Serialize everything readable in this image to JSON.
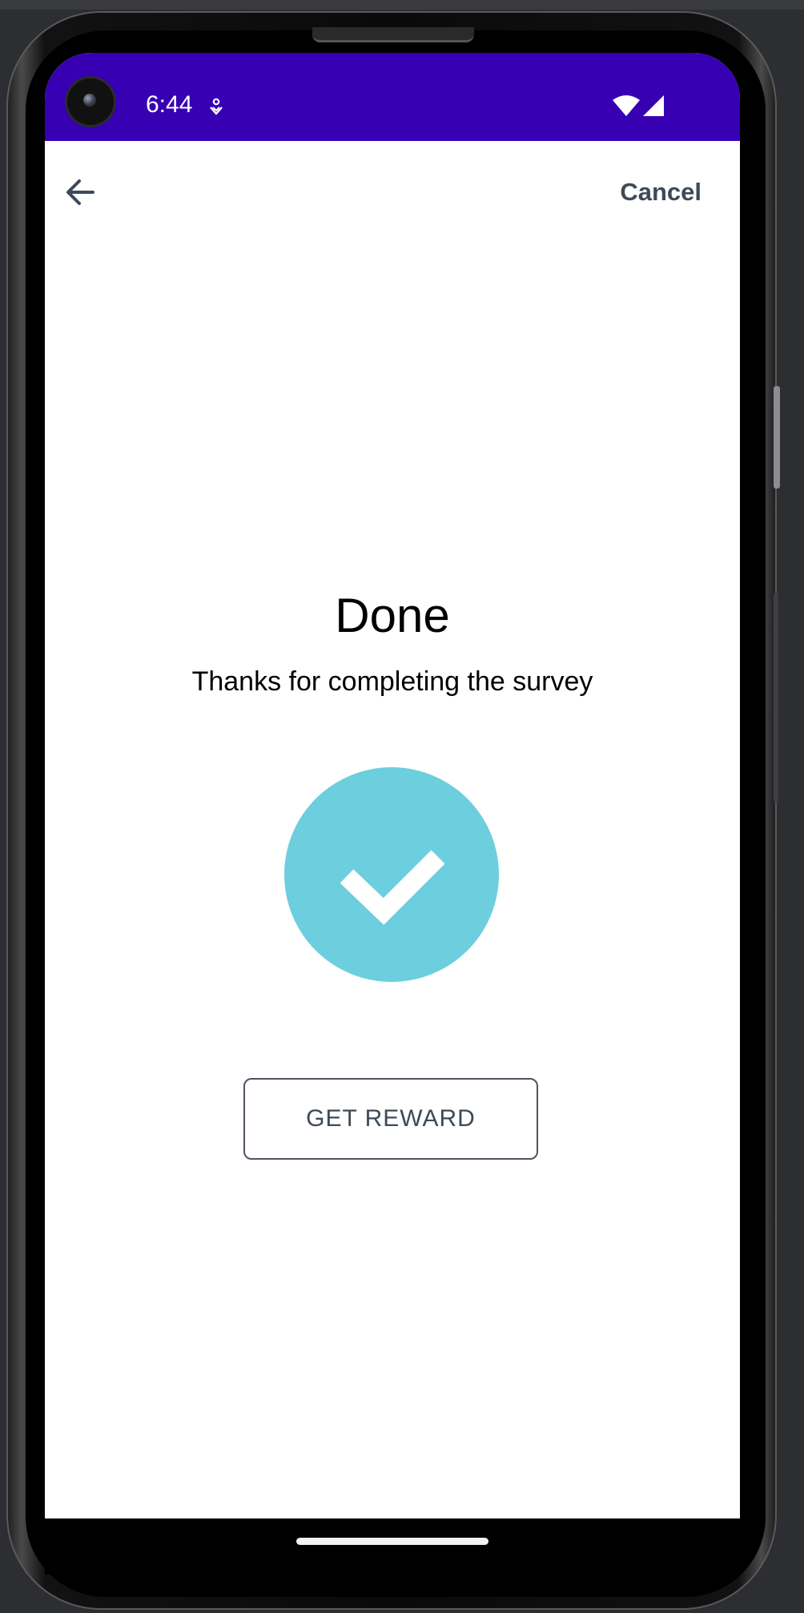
{
  "status_bar": {
    "time": "6:44",
    "notification_icon": "notification-pin-icon",
    "wifi_icon": "wifi-icon",
    "signal_icon": "cell-signal-icon",
    "color": "#3700b3"
  },
  "toolbar": {
    "back_icon": "arrow-back-icon",
    "cancel_label": "Cancel"
  },
  "completion": {
    "title": "Done",
    "message": "Thanks for completing the survey",
    "icon": "check-circle-icon",
    "icon_color": "#6dcedd"
  },
  "actions": {
    "reward_label": "GET REWARD"
  }
}
